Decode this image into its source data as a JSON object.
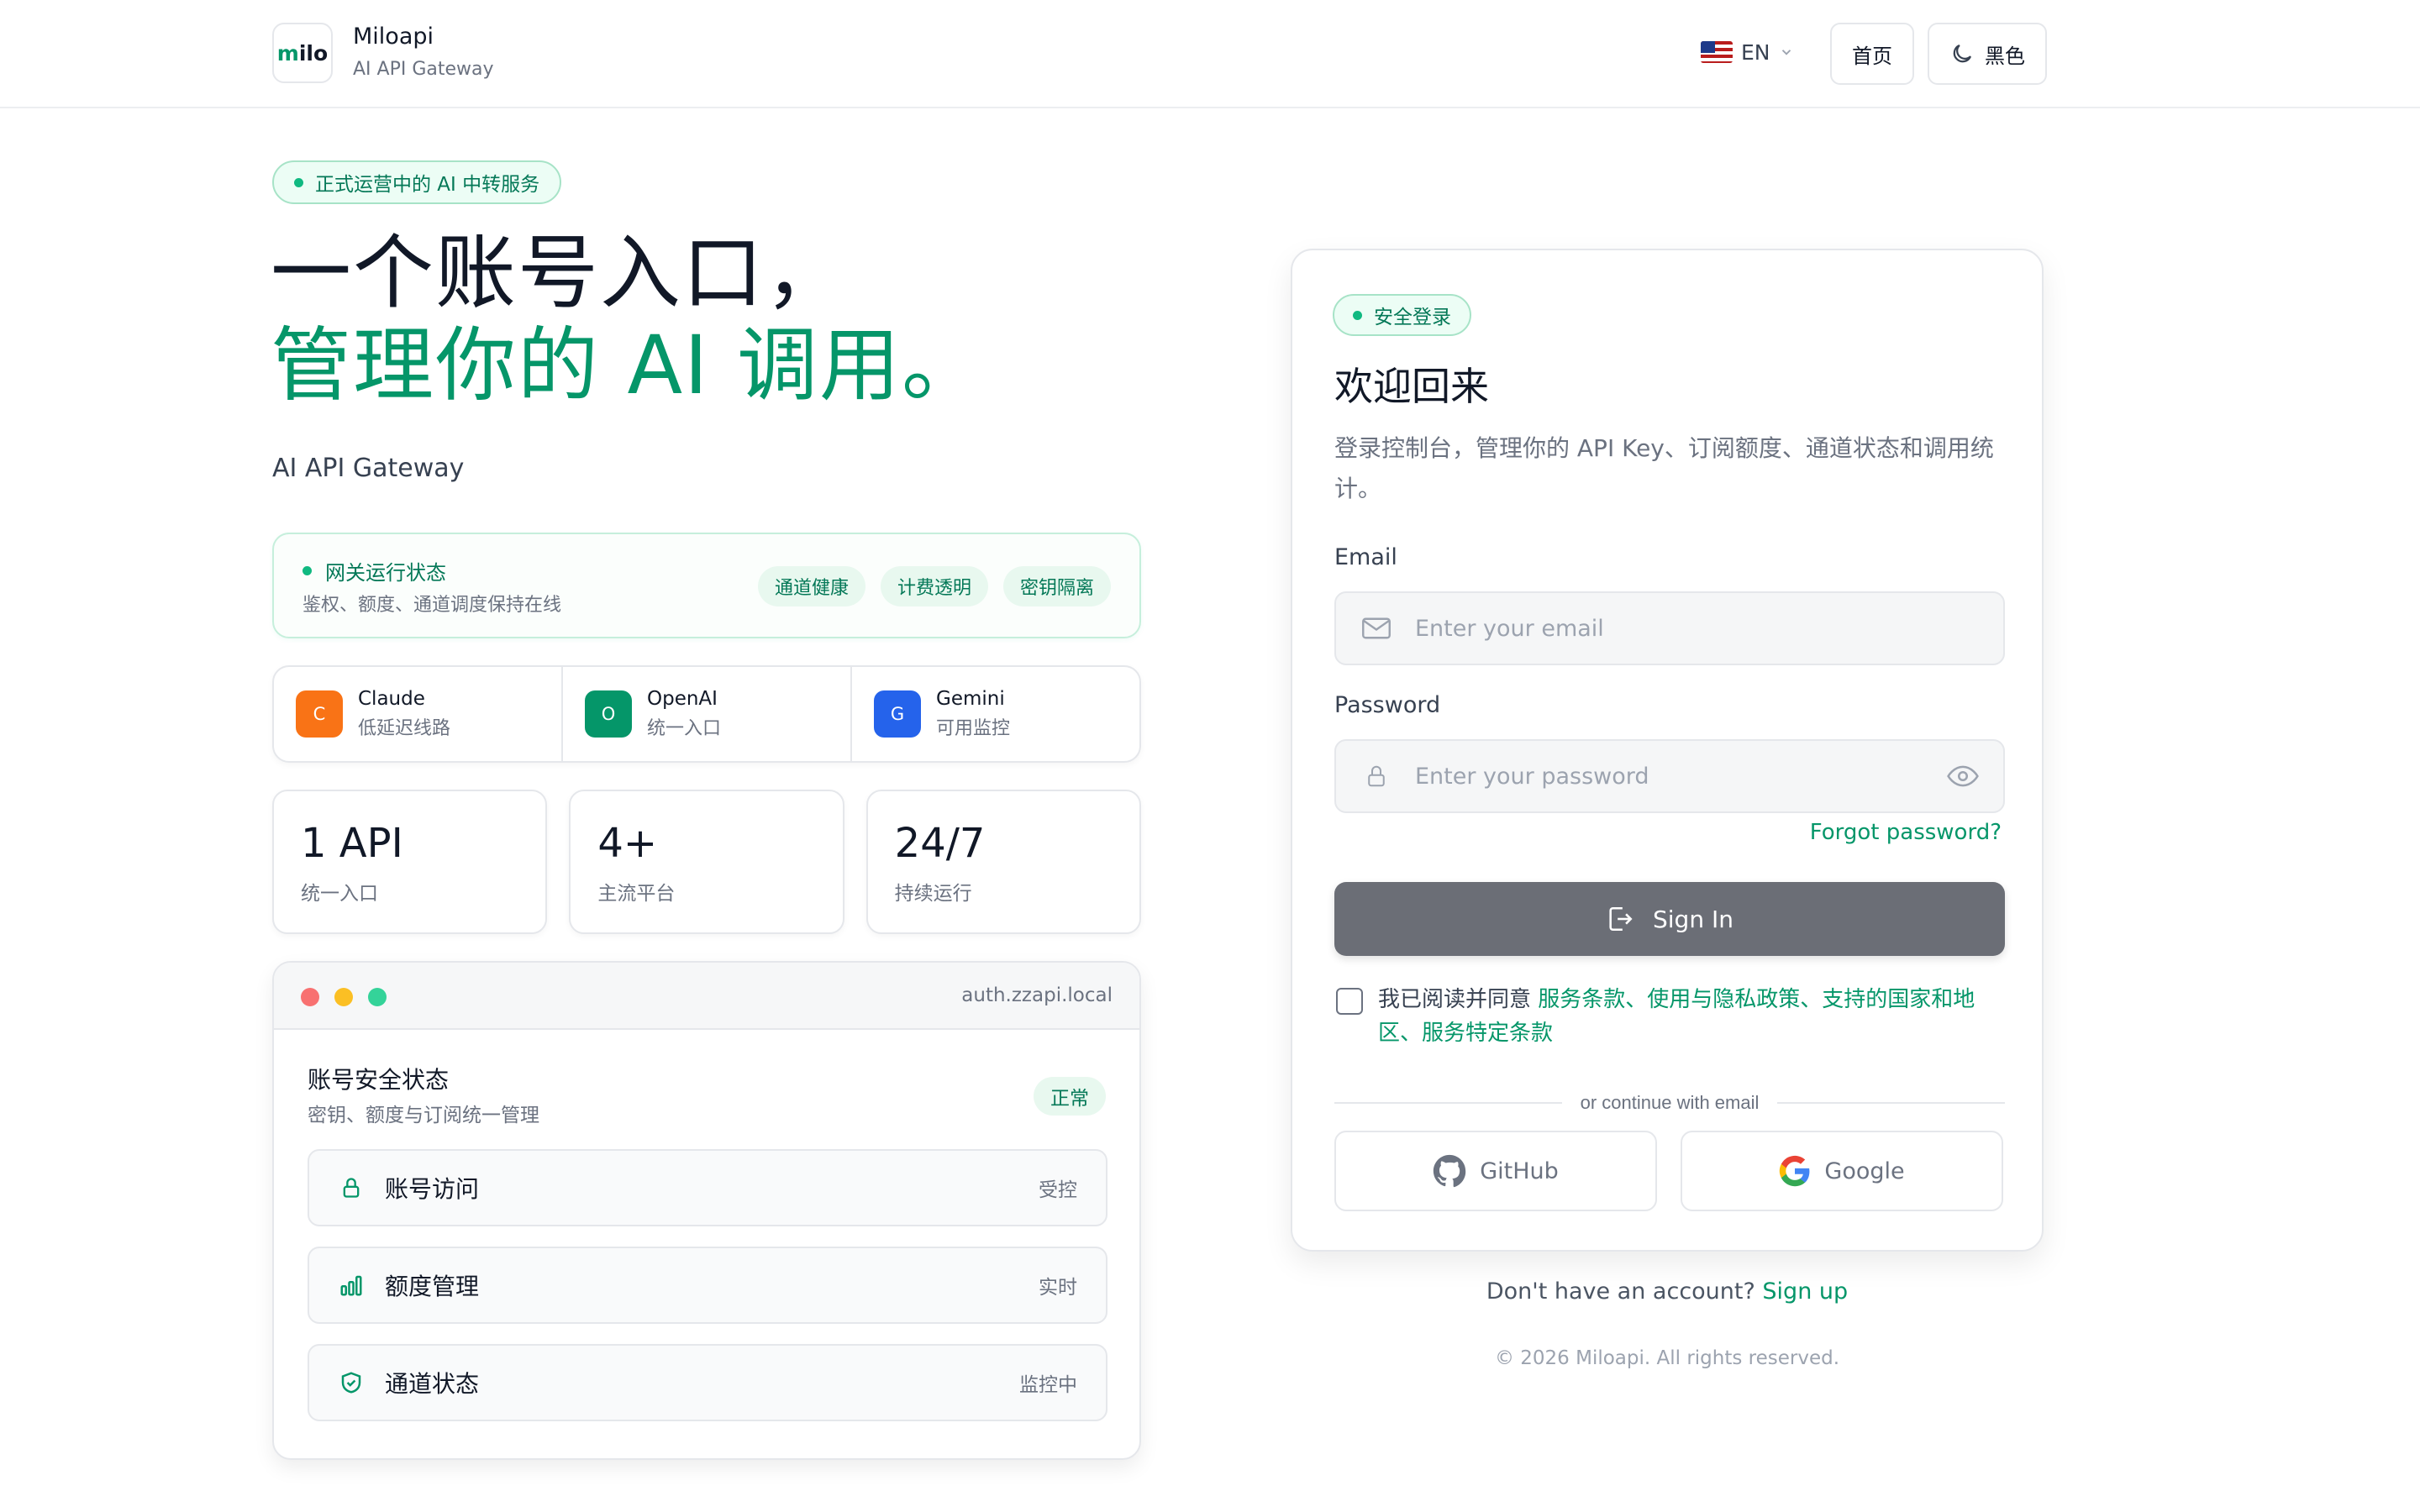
{
  "header": {
    "logo_text": "milo",
    "brand_name": "Miloapi",
    "brand_subtitle": "AI API Gateway",
    "language": "EN",
    "home_label": "首页",
    "theme_label": "黑色"
  },
  "hero": {
    "badge": "正式运营中的 AI 中转服务",
    "title_line1": "一个账号入口，",
    "title_line2": "管理你的 AI 调用。",
    "subtitle": "AI API Gateway"
  },
  "gateway_status": {
    "title": "网关运行状态",
    "description": "鉴权、额度、通道调度保持在线",
    "tags": [
      "通道健康",
      "计费透明",
      "密钥隔离"
    ]
  },
  "providers": [
    {
      "initial": "C",
      "name": "Claude",
      "desc": "低延迟线路",
      "color": "#f97316"
    },
    {
      "initial": "O",
      "name": "OpenAI",
      "desc": "统一入口",
      "color": "#059669"
    },
    {
      "initial": "G",
      "name": "Gemini",
      "desc": "可用监控",
      "color": "#2563eb"
    }
  ],
  "stats": [
    {
      "value": "1 API",
      "label": "统一入口"
    },
    {
      "value": "4+",
      "label": "主流平台"
    },
    {
      "value": "24/7",
      "label": "持续运行"
    }
  ],
  "security": {
    "domain": "auth.zzapi.local",
    "title": "账号安全状态",
    "description": "密钥、额度与订阅统一管理",
    "badge": "正常",
    "rows": [
      {
        "icon": "lock-icon",
        "label": "账号访问",
        "value": "受控"
      },
      {
        "icon": "bar-chart-icon",
        "label": "额度管理",
        "value": "实时"
      },
      {
        "icon": "shield-check-icon",
        "label": "通道状态",
        "value": "监控中"
      }
    ]
  },
  "login": {
    "badge": "安全登录",
    "title": "欢迎回来",
    "description": "登录控制台，管理你的 API Key、订阅额度、通道状态和调用统计。",
    "email_label": "Email",
    "email_placeholder": "Enter your email",
    "password_label": "Password",
    "password_placeholder": "Enter your password",
    "forgot": "Forgot password?",
    "signin": "Sign In",
    "agree_prefix": "我已阅读并同意 ",
    "agree_links": "服务条款、使用与隐私政策、支持的国家和地区、服务特定条款",
    "divider": "or continue with email",
    "github": "GitHub",
    "google": "Google"
  },
  "footer": {
    "no_account": "Don't have an account?",
    "signup": "Sign up",
    "copyright": "© 2026 Miloapi. All rights reserved."
  },
  "colors": {
    "brand_green": "#059669",
    "signin_button": "#6b6e76",
    "traffic_red": "#f87171",
    "traffic_yellow": "#fbbf24",
    "traffic_green": "#34d399"
  }
}
